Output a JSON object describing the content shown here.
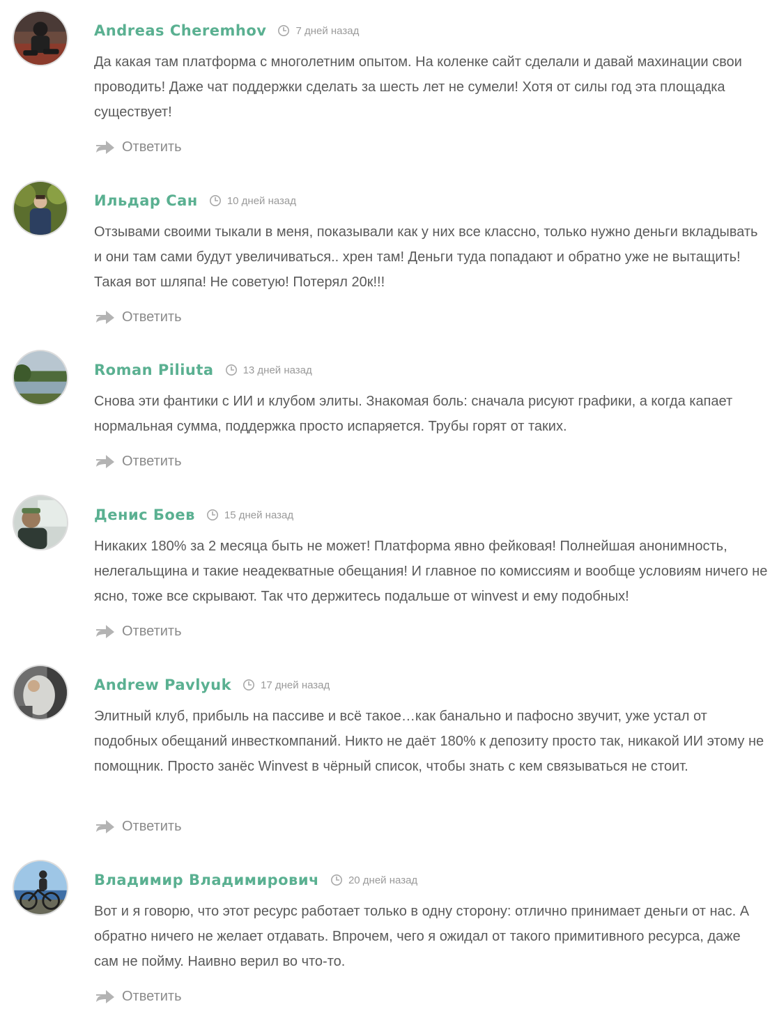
{
  "comments": [
    {
      "author": "Andreas Cheremhov",
      "time": "7 дней назад",
      "text": "Да какая там платформа с многолетним опытом. На коленке сайт сделали и давай махинации свои проводить! Даже чат поддержки сделать за шесть лет не сумели! Хотя от силы год эта площадка существует!",
      "reply_label": "Ответить"
    },
    {
      "author": "Ильдар Сан",
      "time": "10 дней назад",
      "text": "Отзывами своими тыкали в меня, показывали как у них все классно, только нужно деньги вкладывать и они там сами будут увеличиваться.. хрен там! Деньги туда попадают и обратно уже не вытащить! Такая вот шляпа! Не советую! Потерял 20к!!!",
      "reply_label": "Ответить"
    },
    {
      "author": "Roman Piliuta",
      "time": "13 дней назад",
      "text": "Снова эти фантики с ИИ и клубом элиты. Знакомая боль: сначала рисуют графики, а когда капает нормальная сумма, поддержка просто испаряется. Трубы горят от таких.",
      "reply_label": "Ответить"
    },
    {
      "author": "Денис Боев",
      "time": "15 дней назад",
      "text": "Никаких 180% за 2 месяца быть не может! Платформа явно фейковая! Полнейшая анонимность, нелегальщина и такие неадекватные обещания! И главное по комиссиям и вообще условиям ничего не ясно, тоже все скрывают. Так что держитесь подальше от winvest и ему подобных!",
      "reply_label": "Ответить"
    },
    {
      "author": "Andrew Pavlyuk",
      "time": "17 дней назад",
      "text": "Элитный клуб, прибыль на пассиве и всё такое…как банально и пафосно звучит, уже устал от подобных обещаний инвесткомпаний. Никто не даёт 180% к депозиту просто так, никакой ИИ этому не помощник. Просто занёс Winvest в чёрный список, чтобы знать с кем связываться не стоит.",
      "reply_label": "Ответить"
    },
    {
      "author": "Владимир Владимирович",
      "time": "20 дней назад",
      "text": "Вот и я говорю, что этот ресурс работает только в одну сторону: отлично принимает деньги от нас. А обратно ничего не желает отдавать. Впрочем, чего я ожидал от такого примитивного ресурса, даже сам не пойму. Наивно верил во что-то.",
      "reply_label": "Ответить"
    }
  ],
  "icons": {
    "clock": "clock-icon",
    "reply": "reply-arrow-icon"
  },
  "colors": {
    "author": "#5ab091",
    "meta": "#9a9a9a",
    "text": "#5a5a5a",
    "reply": "#8a8a8a"
  }
}
